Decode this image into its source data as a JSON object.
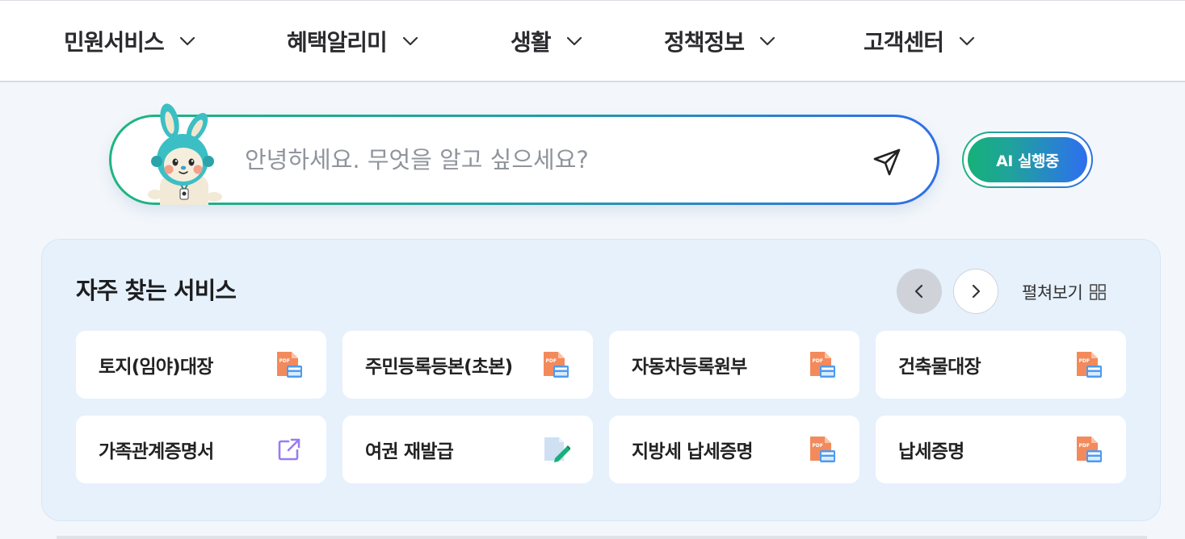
{
  "nav": {
    "items": [
      {
        "label": "민원서비스"
      },
      {
        "label": "혜택알리미"
      },
      {
        "label": "생활"
      },
      {
        "label": "정책정보"
      },
      {
        "label": "고객센터"
      }
    ]
  },
  "search": {
    "placeholder": "안녕하세요. 무엇을 알고 싶으세요?",
    "ai_button_label": "AI 실행중"
  },
  "frequent": {
    "title": "자주 찾는 서비스",
    "expand_label": "펼쳐보기",
    "cards": [
      {
        "label": "토지(임야)대장",
        "icon": "pdf-document-icon"
      },
      {
        "label": "주민등록등본(초본)",
        "icon": "pdf-document-icon"
      },
      {
        "label": "자동차등록원부",
        "icon": "pdf-document-icon"
      },
      {
        "label": "건축물대장",
        "icon": "pdf-document-icon"
      },
      {
        "label": "가족관계증명서",
        "icon": "external-link-icon"
      },
      {
        "label": "여권 재발급",
        "icon": "edit-document-icon"
      },
      {
        "label": "지방세 납세증명",
        "icon": "pdf-document-icon"
      },
      {
        "label": "납세증명",
        "icon": "pdf-document-icon"
      }
    ]
  },
  "colors": {
    "gradient_start": "#1fb57f",
    "gradient_end": "#2f6fe6",
    "panel_bg": "#e6f1fc",
    "page_bg": "#f3f7fb"
  }
}
